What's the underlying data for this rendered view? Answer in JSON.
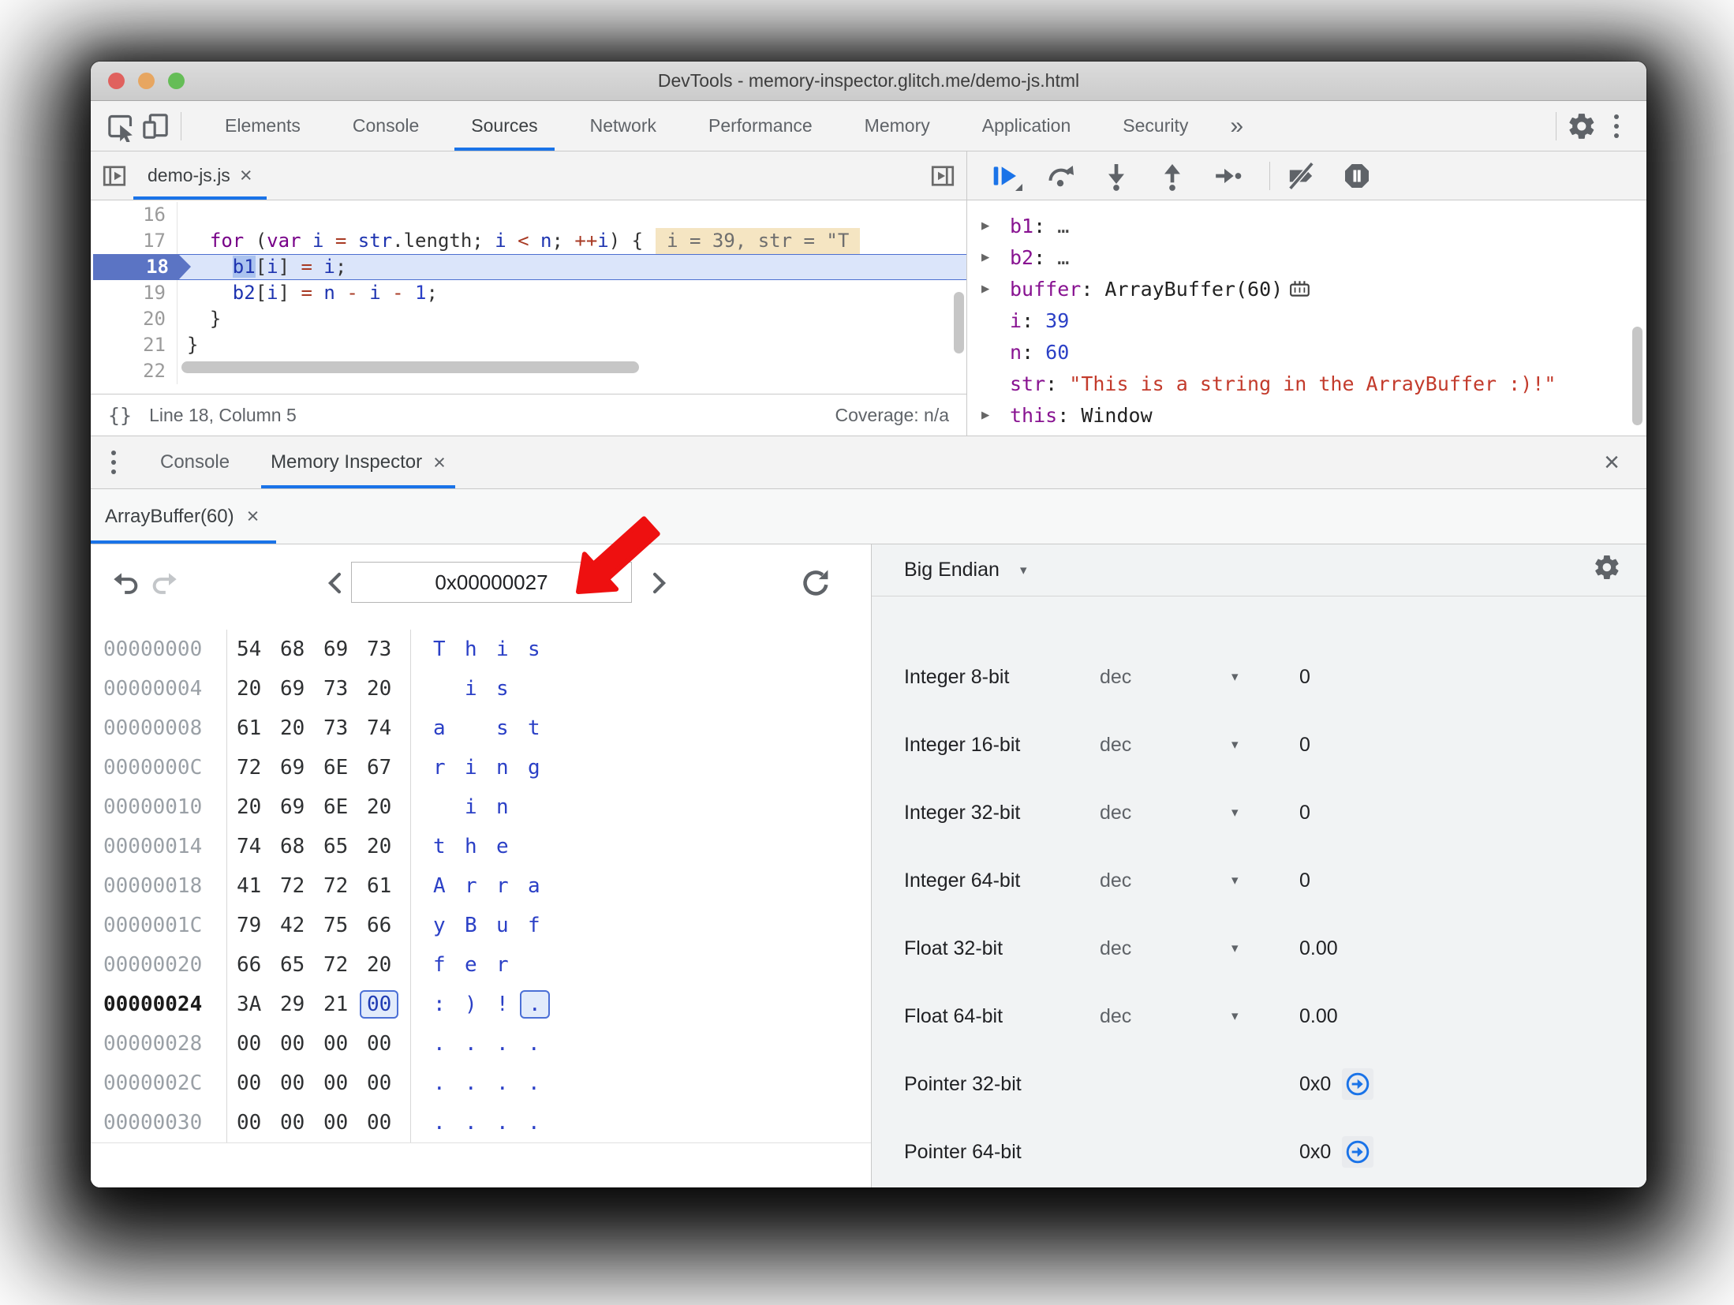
{
  "ui": {
    "close": "×"
  },
  "window": {
    "title": "DevTools - memory-inspector.glitch.me/demo-js.html"
  },
  "main_toolbar": {
    "tabs": [
      {
        "label": "Elements"
      },
      {
        "label": "Console"
      },
      {
        "label": "Sources",
        "active": true
      },
      {
        "label": "Network"
      },
      {
        "label": "Performance"
      },
      {
        "label": "Memory"
      },
      {
        "label": "Application"
      },
      {
        "label": "Security"
      }
    ],
    "more_label": "»"
  },
  "sources": {
    "file_tab": "demo-js.js",
    "braces_label": "{}",
    "status_left": "Line 18, Column 5",
    "status_right": "Coverage: n/a",
    "lines": [
      {
        "num": "16",
        "tokens": []
      },
      {
        "num": "17",
        "tokens": [
          [
            "  ",
            "pl"
          ],
          [
            "for",
            "kw"
          ],
          [
            " (",
            "pl"
          ],
          [
            "var",
            "kw"
          ],
          [
            " ",
            "pl"
          ],
          [
            "i",
            "vr"
          ],
          [
            " ",
            "pl"
          ],
          [
            "=",
            "op"
          ],
          [
            " ",
            "pl"
          ],
          [
            "str",
            "vr"
          ],
          [
            ".length; ",
            "pl"
          ],
          [
            "i",
            "vr"
          ],
          [
            " ",
            "pl"
          ],
          [
            "<",
            "op"
          ],
          [
            " ",
            "pl"
          ],
          [
            "n",
            "vr"
          ],
          [
            "; ",
            "pl"
          ],
          [
            "++",
            "op"
          ],
          [
            "i",
            "vr"
          ],
          [
            ") {",
            "pl"
          ]
        ],
        "hint": "i = 39, str = \"T"
      },
      {
        "num": "18",
        "current": true,
        "tokens": [
          [
            "    ",
            "pl"
          ],
          [
            "b1",
            "vr sel"
          ],
          [
            "[",
            "pl"
          ],
          [
            "i",
            "vr"
          ],
          [
            "] ",
            "pl"
          ],
          [
            "=",
            "op"
          ],
          [
            " ",
            "pl"
          ],
          [
            "i",
            "vr"
          ],
          [
            ";",
            "pl"
          ]
        ]
      },
      {
        "num": "19",
        "tokens": [
          [
            "    ",
            "pl"
          ],
          [
            "b2",
            "vr"
          ],
          [
            "[",
            "pl"
          ],
          [
            "i",
            "vr"
          ],
          [
            "] ",
            "pl"
          ],
          [
            "=",
            "op"
          ],
          [
            " ",
            "pl"
          ],
          [
            "n",
            "vr"
          ],
          [
            " ",
            "pl"
          ],
          [
            "-",
            "op"
          ],
          [
            " ",
            "pl"
          ],
          [
            "i",
            "vr"
          ],
          [
            " ",
            "pl"
          ],
          [
            "-",
            "op"
          ],
          [
            " ",
            "pl"
          ],
          [
            "1",
            "num"
          ],
          [
            ";",
            "pl"
          ]
        ]
      },
      {
        "num": "20",
        "tokens": [
          [
            "  }",
            "pl"
          ]
        ]
      },
      {
        "num": "21",
        "tokens": [
          [
            "}",
            "pl"
          ]
        ]
      },
      {
        "num": "22",
        "tokens": []
      }
    ]
  },
  "debugger": {
    "scope": [
      {
        "expandable": true,
        "name": "b1",
        "value": "…",
        "vtype": "dim"
      },
      {
        "expandable": true,
        "name": "b2",
        "value": "…",
        "vtype": "dim"
      },
      {
        "expandable": true,
        "name": "buffer",
        "value": "ArrayBuffer(60)",
        "vtype": "plain",
        "memory_icon": true
      },
      {
        "expandable": false,
        "name": "i",
        "value": "39",
        "vtype": "num"
      },
      {
        "expandable": false,
        "name": "n",
        "value": "60",
        "vtype": "num"
      },
      {
        "expandable": false,
        "name": "str",
        "value": "\"This is a string in the ArrayBuffer :)!\"",
        "vtype": "str"
      },
      {
        "expandable": true,
        "name": "this",
        "value": "Window",
        "vtype": "plain"
      }
    ]
  },
  "drawer": {
    "tabs": [
      {
        "label": "Console"
      },
      {
        "label": "Memory Inspector",
        "closable": true,
        "active": true
      }
    ]
  },
  "memory_inspector": {
    "buffer_tabs": [
      {
        "label": "ArrayBuffer(60)",
        "closable": true,
        "active": true
      }
    ],
    "address_input": "0x00000027",
    "endianness": "Big Endian",
    "rows": [
      {
        "addr": "00000000",
        "bytes": [
          "54",
          "68",
          "69",
          "73"
        ],
        "ascii": [
          "T",
          "h",
          "i",
          "s"
        ]
      },
      {
        "addr": "00000004",
        "bytes": [
          "20",
          "69",
          "73",
          "20"
        ],
        "ascii": [
          "",
          "i",
          "s",
          ""
        ]
      },
      {
        "addr": "00000008",
        "bytes": [
          "61",
          "20",
          "73",
          "74"
        ],
        "ascii": [
          "a",
          "",
          "s",
          "t"
        ]
      },
      {
        "addr": "0000000C",
        "bytes": [
          "72",
          "69",
          "6E",
          "67"
        ],
        "ascii": [
          "r",
          "i",
          "n",
          "g"
        ]
      },
      {
        "addr": "00000010",
        "bytes": [
          "20",
          "69",
          "6E",
          "20"
        ],
        "ascii": [
          "",
          "i",
          "n",
          ""
        ]
      },
      {
        "addr": "00000014",
        "bytes": [
          "74",
          "68",
          "65",
          "20"
        ],
        "ascii": [
          "t",
          "h",
          "e",
          ""
        ]
      },
      {
        "addr": "00000018",
        "bytes": [
          "41",
          "72",
          "72",
          "61"
        ],
        "ascii": [
          "A",
          "r",
          "r",
          "a"
        ]
      },
      {
        "addr": "0000001C",
        "bytes": [
          "79",
          "42",
          "75",
          "66"
        ],
        "ascii": [
          "y",
          "B",
          "u",
          "f"
        ]
      },
      {
        "addr": "00000020",
        "bytes": [
          "66",
          "65",
          "72",
          "20"
        ],
        "ascii": [
          "f",
          "e",
          "r",
          ""
        ]
      },
      {
        "addr": "00000024",
        "current": true,
        "selected": 3,
        "bytes": [
          "3A",
          "29",
          "21",
          "00"
        ],
        "ascii": [
          ":",
          ")",
          "!",
          "."
        ]
      },
      {
        "addr": "00000028",
        "bytes": [
          "00",
          "00",
          "00",
          "00"
        ],
        "ascii": [
          ".",
          ".",
          ".",
          "."
        ]
      },
      {
        "addr": "0000002C",
        "bytes": [
          "00",
          "00",
          "00",
          "00"
        ],
        "ascii": [
          ".",
          ".",
          ".",
          "."
        ]
      },
      {
        "addr": "00000030",
        "bytes": [
          "00",
          "00",
          "00",
          "00"
        ],
        "ascii": [
          ".",
          ".",
          ".",
          "."
        ]
      }
    ],
    "values": [
      {
        "label": "Integer 8-bit",
        "format": "dec",
        "value": "0"
      },
      {
        "label": "Integer 16-bit",
        "format": "dec",
        "value": "0"
      },
      {
        "label": "Integer 32-bit",
        "format": "dec",
        "value": "0"
      },
      {
        "label": "Integer 64-bit",
        "format": "dec",
        "value": "0"
      },
      {
        "label": "Float 32-bit",
        "format": "dec",
        "value": "0.00"
      },
      {
        "label": "Float 64-bit",
        "format": "dec",
        "value": "0.00"
      },
      {
        "label": "Pointer 32-bit",
        "format": "",
        "value": "0x0",
        "pointer": true
      },
      {
        "label": "Pointer 64-bit",
        "format": "",
        "value": "0x0",
        "pointer": true
      }
    ]
  }
}
